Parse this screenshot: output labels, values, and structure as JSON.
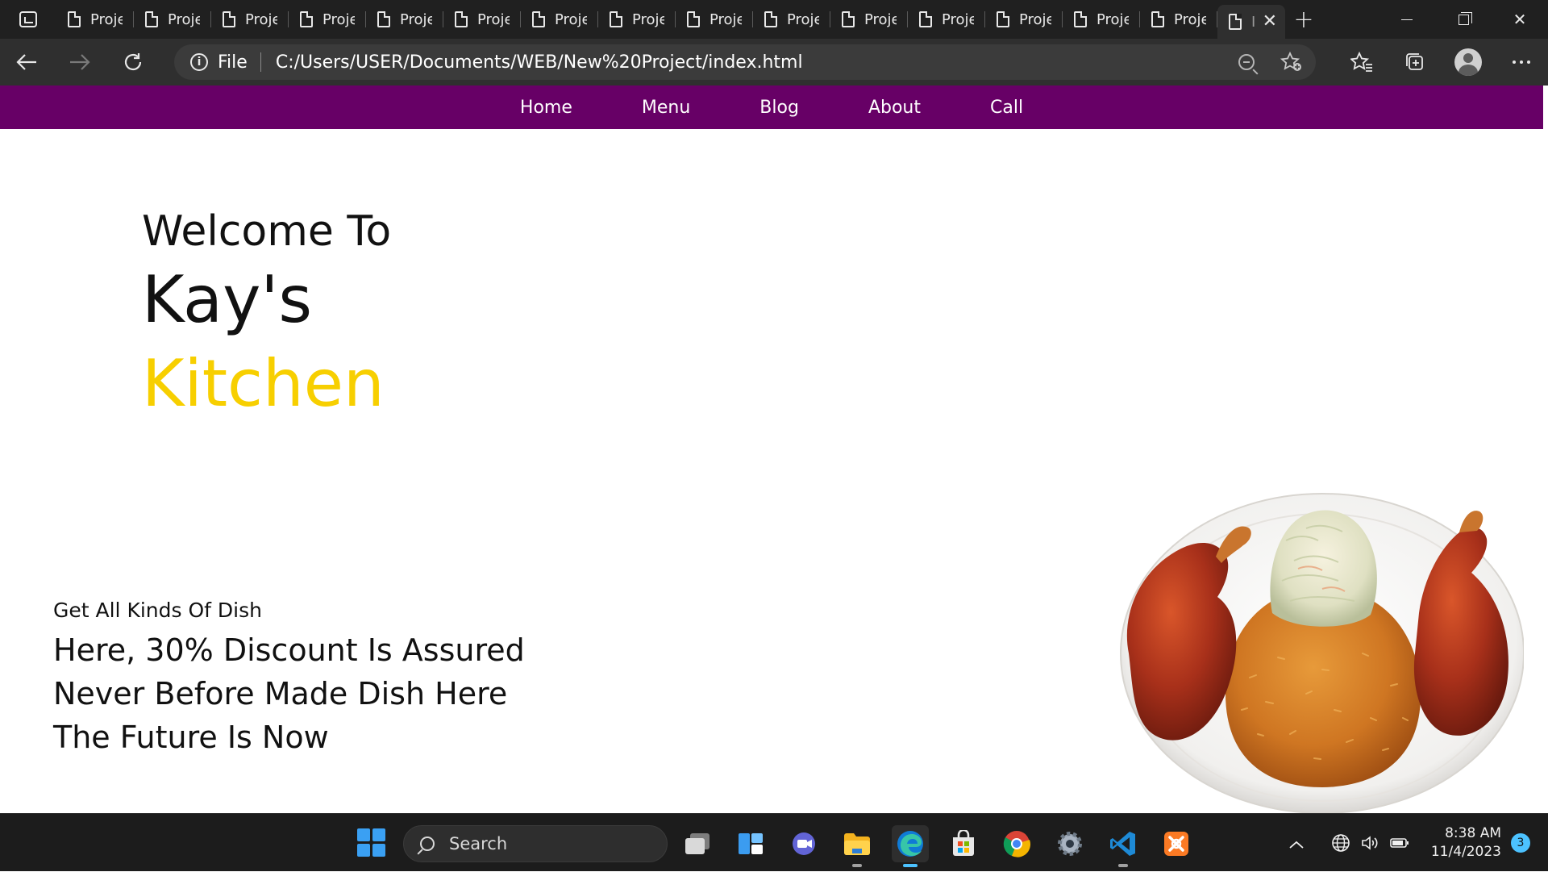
{
  "browser": {
    "tabs": [
      {
        "label": "Proje"
      },
      {
        "label": "Proje"
      },
      {
        "label": "Proje"
      },
      {
        "label": "Proje"
      },
      {
        "label": "Proje"
      },
      {
        "label": "Proje"
      },
      {
        "label": "Proje"
      },
      {
        "label": "Proje"
      },
      {
        "label": "Proje"
      },
      {
        "label": "Proje"
      },
      {
        "label": "Proje"
      },
      {
        "label": "Proje"
      },
      {
        "label": "Proje"
      },
      {
        "label": "Proje"
      },
      {
        "label": "Proje"
      }
    ],
    "active_tab": {
      "label": "I",
      "close_glyph": "✕"
    },
    "new_tab_glyph": "+",
    "window_close_glyph": "✕",
    "address": {
      "scheme_label": "File",
      "url": "C:/Users/USER/Documents/WEB/New%20Project/index.html"
    }
  },
  "site": {
    "nav": {
      "items": [
        {
          "label": "Home"
        },
        {
          "label": "Menu"
        },
        {
          "label": "Blog"
        },
        {
          "label": "About"
        },
        {
          "label": "Call"
        }
      ]
    },
    "hero": {
      "line1": "Welcome To",
      "line2": "Kay's",
      "line3": "Kitchen"
    },
    "promo": {
      "small": "Get All Kinds Of Dish",
      "lines": [
        "Here, 30% Discount Is Assured",
        "Never Before Made Dish Here",
        "The Future Is Now"
      ]
    }
  },
  "taskbar": {
    "search_label": "Search",
    "clock_time": "8:38 AM",
    "clock_date": "11/4/2023",
    "notification_count": "3"
  },
  "colors": {
    "nav_bg": "#670066",
    "kitchen_yellow": "#f7cf00",
    "tab_strip_bg": "#202020",
    "taskbar_bg": "#1c1c1c"
  }
}
